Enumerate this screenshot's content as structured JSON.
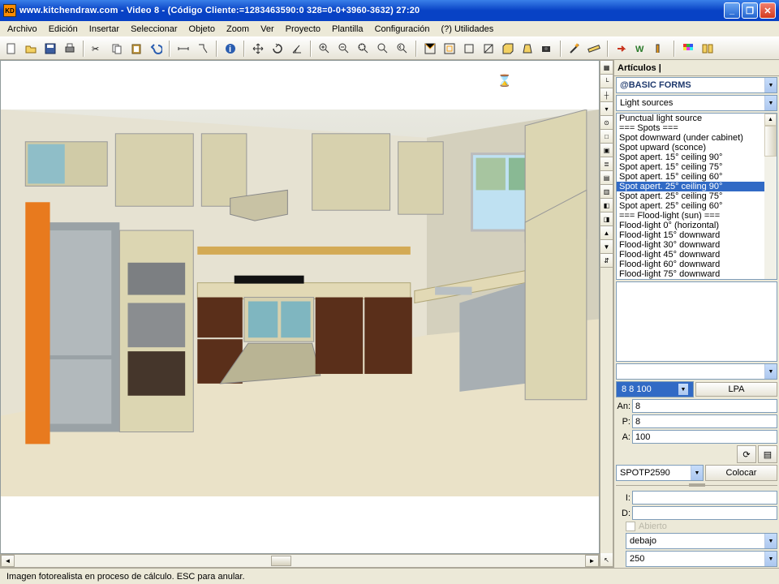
{
  "title": "www.kitchendraw.com - Video 8 - (Código Cliente:=1283463590:0 328=0-0+3960-3632) 27:20",
  "app_icon": "KD",
  "menu": [
    "Archivo",
    "Edición",
    "Insertar",
    "Seleccionar",
    "Objeto",
    "Zoom",
    "Ver",
    "Proyecto",
    "Plantilla",
    "Configuración",
    "(?) Utilidades"
  ],
  "panel": {
    "title": "Artículos",
    "catalog": "@BASIC FORMS",
    "category": "Light sources",
    "items": [
      "Punctual light source",
      "=== Spots ===",
      "Spot downward (under cabinet)",
      "Spot upward (sconce)",
      "Spot apert. 15° ceiling 90°",
      "Spot apert. 15° ceiling 75°",
      "Spot apert. 15° ceiling 60°",
      "Spot apert. 25° ceiling 90°",
      "Spot apert. 25° ceiling 75°",
      "Spot apert. 25° ceiling 60°",
      "=== Flood-light (sun) ===",
      "Flood-light 0° (horizontal)",
      "Flood-light 15° downward",
      "Flood-light 30° downward",
      "Flood-light 45° downward",
      "Flood-light 60° downward",
      "Flood-light 75° downward"
    ],
    "selected_index": 7,
    "dims": "8   8 100",
    "lpa": "LPA",
    "an_label": "An:",
    "an": "8",
    "p_label": "P:",
    "p": "8",
    "a_label": "A:",
    "a": "100",
    "ref": "SPOTP2590",
    "colocar": "Colocar",
    "i_label": "I:",
    "i": "",
    "d_label": "D:",
    "d": "",
    "abierto": "Abierto",
    "pos": "debajo",
    "pos2": "250"
  },
  "status": "Imagen fotorealista en proceso de cálculo. ESC para anular."
}
